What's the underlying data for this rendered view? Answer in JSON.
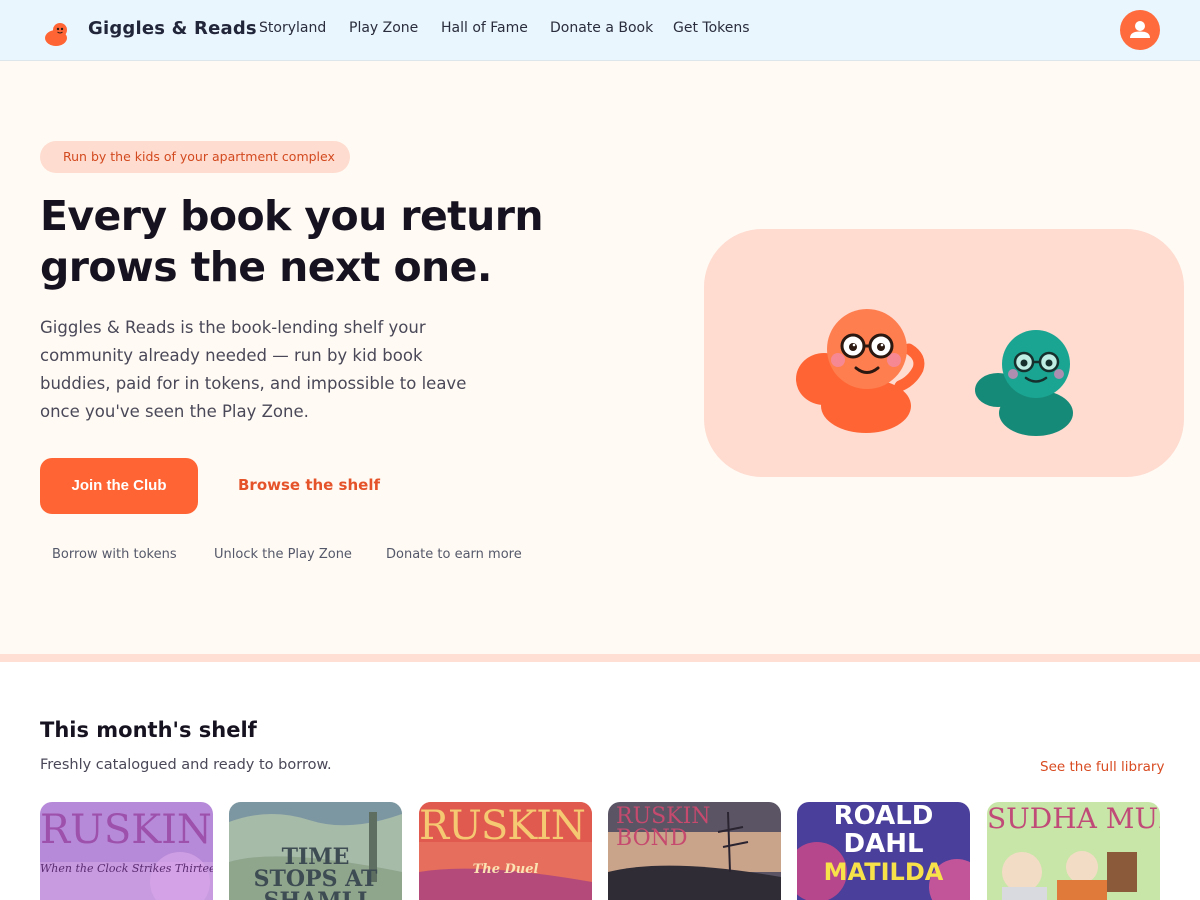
{
  "nav": {
    "brand": "Giggles & Reads",
    "links": [
      "Storyland",
      "Play Zone",
      "Hall of Fame",
      "Donate a Book",
      "Get Tokens"
    ]
  },
  "hero": {
    "badge": "Run by the kids of your apartment complex",
    "title_line1": "Every book you return",
    "title_line2": "grows the next one.",
    "description": "Giggles & Reads is the book-lending shelf your community already needed — run by kid book buddies, paid for in tokens, and impossible to leave once you've seen the Play Zone.",
    "primary_cta": "Join the Club",
    "secondary_cta": "Browse the shelf",
    "features": [
      "Borrow with tokens",
      "Unlock the Play Zone",
      "Donate to earn more"
    ]
  },
  "shelf": {
    "title": "This month's shelf",
    "subtitle": "Freshly catalogued and ready to borrow.",
    "see_all": "See the full library",
    "books": [
      {
        "author": "RUSKIN BOND",
        "title": "When the Clock Strikes Thirteen",
        "bg": "#b68ad8",
        "text": "#9b4aa8"
      },
      {
        "author": "",
        "title": "TIME STOPS AT SHAMLI",
        "bg": "#9fb3a3",
        "text": "#3d4b52"
      },
      {
        "author": "RUSKIN BOND",
        "title": "The Duel",
        "bg": "#e66b5a",
        "text": "#f5c872"
      },
      {
        "author": "RUSKIN BOND",
        "title": "",
        "bg": "#6f6878",
        "text": "#c54a6e"
      },
      {
        "author": "ROALD DAHL",
        "title": "MATILDA",
        "bg": "#4a3f9a",
        "text": "#f8e24a"
      },
      {
        "author": "SUDHA MURTY",
        "title": "",
        "bg": "#bfe0a0",
        "text": "#c04a78"
      }
    ]
  },
  "colors": {
    "accent": "#ff6534",
    "nav_bg": "#eaf6fd",
    "hero_bg": "#fffbf4",
    "art_bg": "#ffdbd0"
  }
}
